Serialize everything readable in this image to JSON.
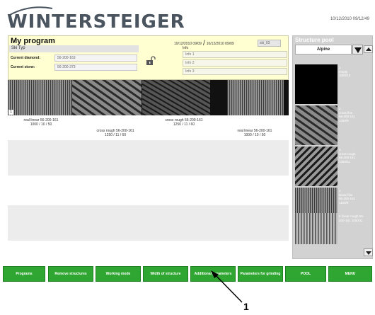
{
  "header": {
    "logo_text": "WINTERSTEIGER",
    "datetime": "10/12/2010 09/12/49"
  },
  "program": {
    "title": "My program",
    "date_created": "10/12/2010 09/09",
    "date_modified": "10/12/2010 09/09",
    "code": "ski_03",
    "type_label": "Ski Typ",
    "current_diamond_label": "Current diamond:",
    "current_diamond_value": "56-200-163",
    "current_stone_label": "Current stone:",
    "current_stone_value": "56-200-373",
    "info_label": "Info",
    "info_1": "Info 1",
    "info_2": "Info 2",
    "info_3": "Info 3"
  },
  "tiles": [
    {
      "num": "1",
      "caption": "real linear 56-200-161\n1000 / 10 / 50"
    },
    {
      "num": "",
      "caption": "cross rough 56-200-161\n1250 / 11 / 60"
    },
    {
      "num": "",
      "caption": "cross rough 56-200-161\n1250 / 11 / 60"
    },
    {
      "num": "",
      "caption": "real linear 56-200-161\n1000 / 10 / 50"
    }
  ],
  "pool": {
    "title": "Structure pool",
    "selected": "Alpine",
    "items": [
      {
        "text": "1\nempty\n1000/10"
      },
      {
        "text": "2\ncross fine\n56-200-161\n1250/9"
      },
      {
        "text": "3\ncross rough\n56-200-161\n1250/11"
      },
      {
        "text": "4\nlinear fine\n56-200-161\n1100/9"
      },
      {
        "text": "5\nlinear rough\n56-200-161\n1000/11"
      }
    ]
  },
  "menu": {
    "programs": "Programs",
    "remove_structures": "Remove structures",
    "working_mode": "Working mode",
    "width_of_structure": "Width of structure",
    "additional_parameters": "Additional parameters",
    "parameters_for_grinding": "Parameters for grinding",
    "pool": "POOL",
    "menu": "MENU"
  },
  "callout": {
    "number": "1"
  },
  "colors": {
    "menu_green": "#2fa632",
    "program_bg": "#ffffd2",
    "pool_bg": "#d2d2d2"
  }
}
